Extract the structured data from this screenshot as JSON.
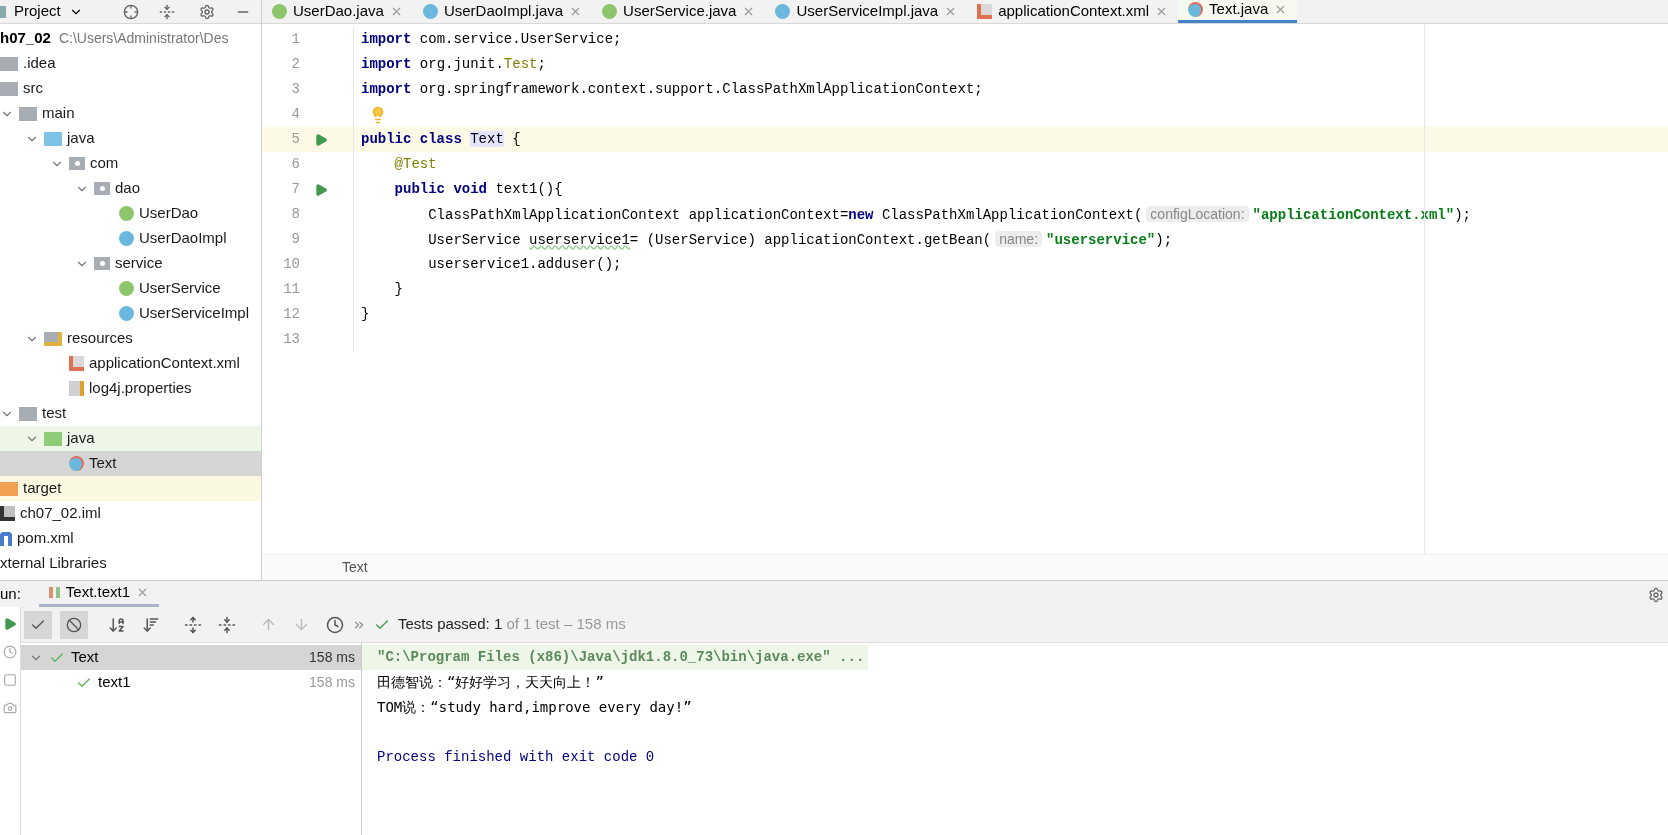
{
  "project_header": {
    "title": "Project"
  },
  "editor_tabs": [
    {
      "label": "UserDao.java",
      "kind": "interface",
      "selected": false
    },
    {
      "label": "UserDaoImpl.java",
      "kind": "class",
      "selected": false
    },
    {
      "label": "UserService.java",
      "kind": "interface",
      "selected": false
    },
    {
      "label": "UserServiceImpl.java",
      "kind": "class",
      "selected": false
    },
    {
      "label": "applicationContext.xml",
      "kind": "xml",
      "selected": false
    },
    {
      "label": "Text.java",
      "kind": "test",
      "selected": true
    }
  ],
  "project_tree": {
    "root": {
      "label": "h07_02",
      "path": "C:\\Users\\Administrator\\Des"
    },
    "items": [
      {
        "label": ".idea",
        "kind": "folder",
        "selected": false
      },
      {
        "label": "src",
        "kind": "folder",
        "expanded": true,
        "selected": false,
        "children": [
          {
            "label": "main",
            "kind": "folder",
            "expanded": true,
            "selected": false,
            "children": [
              {
                "label": "java",
                "kind": "source",
                "expanded": true,
                "selected": false,
                "children": [
                  {
                    "label": "com",
                    "kind": "package",
                    "expanded": true,
                    "selected": false,
                    "children": [
                      {
                        "label": "dao",
                        "kind": "package",
                        "expanded": true,
                        "selected": false,
                        "children": [
                          {
                            "label": "UserDao",
                            "kind": "interface",
                            "selected": false
                          },
                          {
                            "label": "UserDaoImpl",
                            "kind": "class",
                            "selected": false
                          }
                        ]
                      },
                      {
                        "label": "service",
                        "kind": "package",
                        "expanded": true,
                        "selected": false,
                        "children": [
                          {
                            "label": "UserService",
                            "kind": "interface",
                            "selected": false
                          },
                          {
                            "label": "UserServiceImpl",
                            "kind": "class",
                            "selected": false
                          }
                        ]
                      }
                    ]
                  }
                ]
              },
              {
                "label": "resources",
                "kind": "resources",
                "expanded": true,
                "selected": false,
                "children": [
                  {
                    "label": "applicationContext.xml",
                    "kind": "xml",
                    "selected": false
                  },
                  {
                    "label": "log4j.properties",
                    "kind": "properties",
                    "selected": false
                  }
                ]
              }
            ]
          },
          {
            "label": "test",
            "kind": "folder",
            "expanded": true,
            "selected": false,
            "children": [
              {
                "label": "java",
                "kind": "test_root",
                "expanded": true,
                "selected": false,
                "children": [
                  {
                    "label": "Text",
                    "kind": "test",
                    "selected": true
                  }
                ]
              }
            ]
          }
        ]
      },
      {
        "label": "target",
        "kind": "excluded",
        "selected": false
      },
      {
        "label": "ch07_02.iml",
        "kind": "iml",
        "selected": false
      },
      {
        "label": "pom.xml",
        "kind": "maven",
        "selected": false
      },
      {
        "label": "xternal Libraries",
        "kind": "libraries",
        "selected": false
      }
    ]
  },
  "code_lines": [
    {
      "number": "1",
      "tokens": [
        {
          "kind": "kw",
          "text": "import"
        },
        {
          "kind": "plain",
          "text": " com.service.UserService;"
        }
      ]
    },
    {
      "number": "2",
      "tokens": [
        {
          "kind": "kw",
          "text": "import"
        },
        {
          "kind": "plain",
          "text": " org.junit."
        },
        {
          "kind": "ann",
          "text": "Test"
        },
        {
          "kind": "plain",
          "text": ";"
        }
      ]
    },
    {
      "number": "3",
      "tokens": [
        {
          "kind": "kw",
          "text": "import"
        },
        {
          "kind": "plain",
          "text": " org.springframework.context.support.ClassPathXmlApplicationContext;"
        }
      ]
    },
    {
      "number": "4",
      "bulb_icon": true
    },
    {
      "number": "5",
      "run_icon": true,
      "current": true,
      "tokens": [
        {
          "kind": "kw",
          "text": "public class "
        },
        {
          "kind": "ident",
          "text": "Text"
        },
        {
          "kind": "plain",
          "text": " {"
        }
      ]
    },
    {
      "number": "6",
      "tokens": [
        {
          "kind": "ann",
          "text": "    @Test"
        }
      ]
    },
    {
      "number": "7",
      "run_icon": true,
      "tokens": [
        {
          "kind": "kw",
          "text": "    public void"
        },
        {
          "kind": "plain",
          "text": " text1(){"
        }
      ]
    },
    {
      "number": "8",
      "tokens": [
        {
          "kind": "plain",
          "text": "        ClassPathXmlApplicationContext applicationContext="
        },
        {
          "kind": "kw",
          "text": "new"
        },
        {
          "kind": "plain",
          "text": " ClassPathXmlApplicationContext("
        },
        {
          "kind": "hint",
          "text": "configLocation:"
        },
        {
          "kind": "str",
          "text": "\"applicationContext.xml\""
        },
        {
          "kind": "plain",
          "text": ");"
        }
      ]
    },
    {
      "number": "9",
      "tokens": [
        {
          "kind": "plain",
          "text": "        UserService "
        },
        {
          "kind": "wavy",
          "text": "userservice1"
        },
        {
          "kind": "plain",
          "text": "= (UserService) applicationContext.getBean("
        },
        {
          "kind": "hint",
          "text": "name:"
        },
        {
          "kind": "str",
          "text": "\"userservice\""
        },
        {
          "kind": "plain",
          "text": ");"
        }
      ]
    },
    {
      "number": "10",
      "tokens": [
        {
          "kind": "plain",
          "text": "        userservice1.adduser();"
        }
      ]
    },
    {
      "number": "11",
      "tokens": [
        {
          "kind": "plain",
          "text": "    }"
        }
      ]
    },
    {
      "number": "12",
      "tokens": [
        {
          "kind": "plain",
          "text": "}"
        }
      ]
    },
    {
      "number": "13"
    }
  ],
  "breadcrumb": "Text",
  "run_panel": {
    "label": "un:",
    "tab": {
      "label": "Text.text1",
      "selected": true
    },
    "status": {
      "bold": "Tests passed: 1",
      "rest": "of 1 test – 158 ms"
    },
    "tests": [
      {
        "label": "Text",
        "time": "158 ms",
        "selected": true,
        "children": [
          {
            "label": "text1",
            "time": "158 ms",
            "selected": false
          }
        ]
      }
    ],
    "console": [
      {
        "kind": "command",
        "text": "\"C:\\Program Files (x86)\\Java\\jdk1.8.0_73\\bin\\java.exe\" ..."
      },
      {
        "kind": "output",
        "text": "田德智说：“好好学习，天天向上！”"
      },
      {
        "kind": "output",
        "text": "TOM说：“study hard,improve every day!”"
      },
      {
        "kind": "exit",
        "text": "Process finished with exit code 0"
      }
    ]
  }
}
